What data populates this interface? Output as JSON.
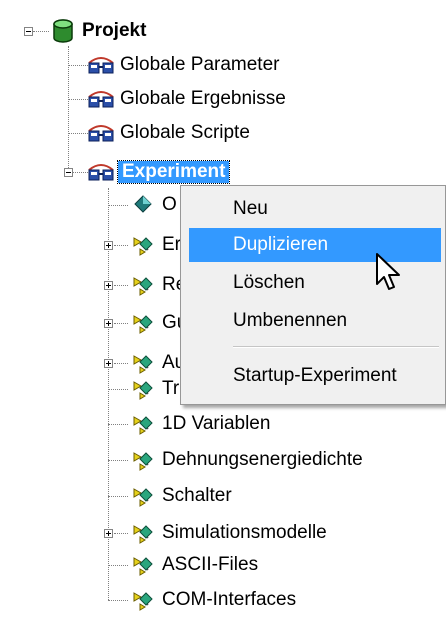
{
  "tree": {
    "root": {
      "label": "Projekt",
      "icon": "database-icon",
      "expanded": true
    },
    "children": [
      {
        "label": "Globale Parameter",
        "icon": "glasses-icon"
      },
      {
        "label": "Globale Ergebnisse",
        "icon": "glasses-icon"
      },
      {
        "label": "Globale Scripte",
        "icon": "glasses-icon"
      },
      {
        "label": "Experiment",
        "icon": "glasses-icon",
        "selected": true,
        "expanded": true
      }
    ],
    "experiment_children": [
      {
        "label": "O",
        "icon": "diamond-icon",
        "expandable": false
      },
      {
        "label": "Er",
        "icon": "node-icon",
        "expandable": true
      },
      {
        "label": "Re",
        "icon": "node-icon",
        "expandable": true
      },
      {
        "label": "Gu",
        "icon": "node-icon",
        "expandable": true
      },
      {
        "label": "Au",
        "icon": "node-icon",
        "expandable": true
      },
      {
        "label": "Tr",
        "icon": "node-icon",
        "expandable": false
      },
      {
        "label": "1D Variablen",
        "icon": "node-icon",
        "expandable": false
      },
      {
        "label": "Dehnungsenergiedichte",
        "icon": "node-icon",
        "expandable": false
      },
      {
        "label": "Schalter",
        "icon": "node-icon",
        "expandable": false
      },
      {
        "label": "Simulationsmodelle",
        "icon": "node-icon",
        "expandable": true
      },
      {
        "label": "ASCII-Files",
        "icon": "node-icon",
        "expandable": false
      },
      {
        "label": "COM-Interfaces",
        "icon": "node-icon",
        "expandable": false
      }
    ]
  },
  "context_menu": {
    "items": [
      {
        "label": "Neu"
      },
      {
        "label": "Duplizieren",
        "highlighted": true
      },
      {
        "label": "Löschen"
      },
      {
        "label": "Umbenennen"
      },
      {
        "label": "Startup-Experiment"
      }
    ]
  },
  "colors": {
    "selection": "#3399ff",
    "menu_background": "#f0f0f0",
    "root_icon": "#2e8b2e"
  }
}
